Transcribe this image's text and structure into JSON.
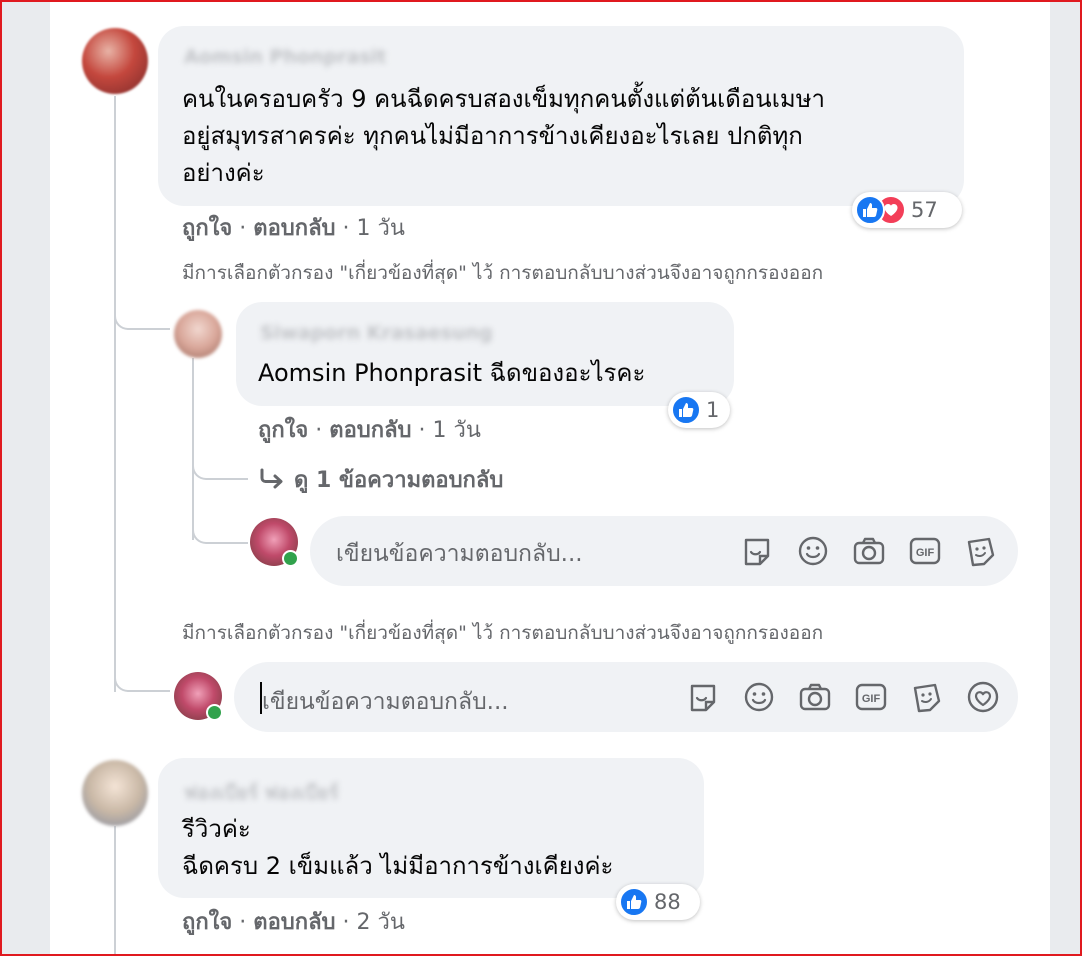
{
  "comments": [
    {
      "author": "Aomsin Phonprasit",
      "lines": [
        "คนในครอบครัว 9 คนฉีดครบสองเข็มทุกคนตั้งแต่ต้นเดือนเมษา",
        "อยู่สมุทรสาครค่ะ ทุกคนไม่มีอาการข้างเคียงอะไรเลย ปกติทุก",
        "อย่างค่ะ"
      ],
      "reaction_count": "57",
      "like_label": "ถูกใจ",
      "reply_label": "ตอบกลับ",
      "time": "1 วัน",
      "filter_note": "มีการเลือกตัวกรอง \"เกี่ยวข้องที่สุด\" ไว้ การตอบกลับบางส่วนจึงอาจถูกกรองออก",
      "reply": {
        "author": "Siwaporn Krasaesung",
        "mention": "Aomsin Phonprasit",
        "text": " ฉีดของอะไรคะ",
        "reaction_count": "1",
        "like_label": "ถูกใจ",
        "reply_label": "ตอบกลับ",
        "time": "1 วัน",
        "view_replies": "ดู 1 ข้อความตอบกลับ",
        "input_placeholder": "เขียนข้อความตอบกลับ..."
      },
      "filter_note_2": "มีการเลือกตัวกรอง \"เกี่ยวข้องที่สุด\" ไว้ การตอบกลับบางส่วนจึงอาจถูกกรองออก",
      "input_placeholder": "เขียนข้อความตอบกลับ..."
    },
    {
      "author": "ฟองเบียร์ ฟองเบียร์",
      "lines": [
        "รีวิวค่ะ",
        "ฉีดครบ 2 เข็มแล้ว ไม่มีอาการข้างเคียงค่ะ"
      ],
      "reaction_count": "88",
      "like_label": "ถูกใจ",
      "reply_label": "ตอบกลับ",
      "time": "2 วัน"
    }
  ],
  "colors": {
    "like_blue": "#1877f2",
    "love_red": "#f33e58",
    "online_green": "#31a24c",
    "bubble_bg": "#f0f2f5",
    "meta_gray": "#65676b"
  },
  "icons": [
    "like-reaction-icon",
    "love-reaction-icon",
    "reply-arrow-icon",
    "sticker-icon",
    "emoji-icon",
    "camera-icon",
    "gif-icon",
    "avatar-sticker-icon",
    "heart-sticker-icon"
  ]
}
